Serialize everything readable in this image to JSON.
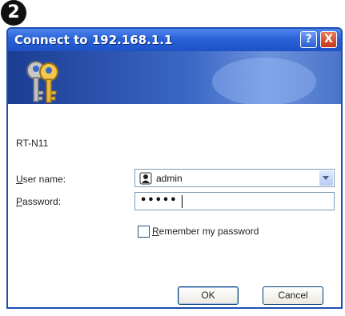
{
  "step_badge": "2",
  "dialog": {
    "title": "Connect to 192.168.1.1",
    "help_button": "?",
    "close_button": "X",
    "realm": "RT-N11",
    "username_label_accel": "U",
    "username_label_rest": "ser name:",
    "username_value": "admin",
    "password_label_accel": "P",
    "password_label_rest": "assword:",
    "password_mask": "•••••",
    "remember_accel": "R",
    "remember_rest": "emember my password",
    "remember_checked": false,
    "ok_label": "OK",
    "cancel_label": "Cancel"
  },
  "colors": {
    "titlebar": "#2a62d8",
    "banner": "#3c68c6",
    "dialog_body": "#ffffff"
  },
  "icons": [
    "keys-icon",
    "user-avatar-icon",
    "chevron-down-icon",
    "help-icon",
    "close-icon"
  ]
}
